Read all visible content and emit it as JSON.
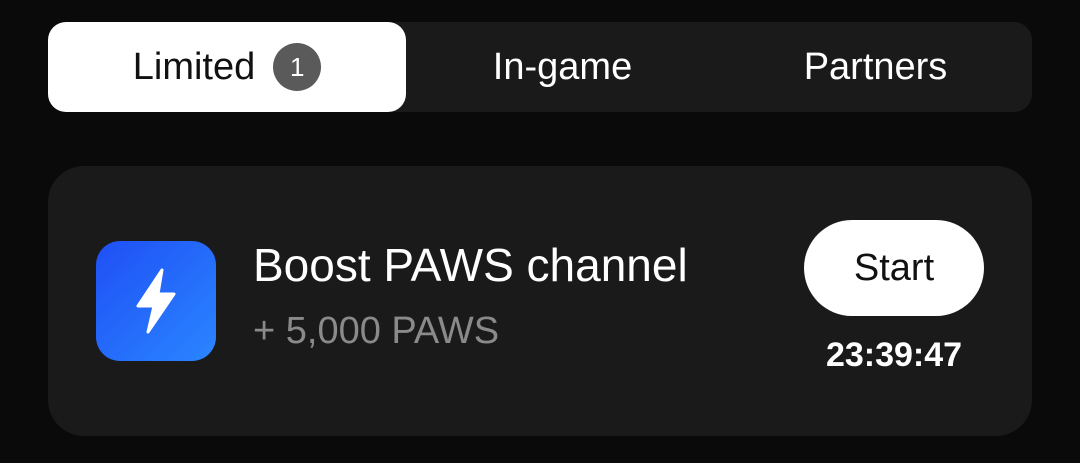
{
  "tabs": [
    {
      "label": "Limited",
      "badge": "1",
      "active": true
    },
    {
      "label": "In-game",
      "active": false
    },
    {
      "label": "Partners",
      "active": false
    }
  ],
  "task": {
    "icon": "lightning-bolt-icon",
    "title": "Boost PAWS channel",
    "reward": "+ 5,000 PAWS",
    "start_label": "Start",
    "timer": "23:39:47"
  },
  "colors": {
    "background": "#0a0a0a",
    "panel": "#1a1a1a",
    "icon_gradient_start": "#1f4ff5",
    "icon_gradient_end": "#2a86ff",
    "badge": "#5a5a5a",
    "reward_text": "#8a8a8a"
  }
}
